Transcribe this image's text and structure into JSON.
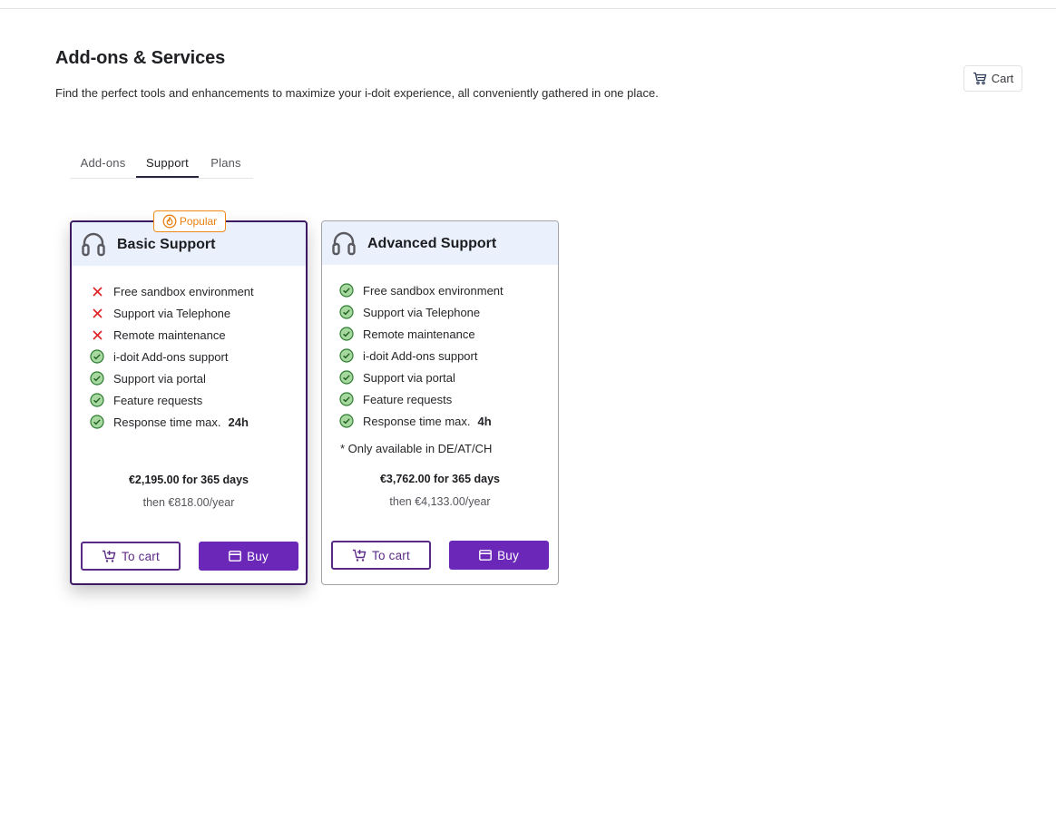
{
  "header": {
    "title": "Add-ons & Services",
    "subtitle": "Find the perfect tools and enhancements to maximize your i-doit experience, all conveniently gathered in one place.",
    "cart_label": "Cart",
    "cart_icon": "cart-icon"
  },
  "tabs": [
    {
      "label": "Add-ons",
      "active": false
    },
    {
      "label": "Support",
      "active": true
    },
    {
      "label": "Plans",
      "active": false
    }
  ],
  "colors": {
    "accent": "#6a27b8",
    "card_header_bg": "#eaf1fc",
    "popular": "#ef8a1a",
    "check": "#43a047",
    "cross": "#e02020"
  },
  "cards": [
    {
      "title": "Basic Support",
      "icon": "headset-icon",
      "badge": "Popular",
      "features": [
        {
          "label": "Free sandbox environment",
          "included": false
        },
        {
          "label": "Support via Telephone",
          "included": false
        },
        {
          "label": "Remote maintenance",
          "included": false
        },
        {
          "label": "i-doit Add-ons support",
          "included": true
        },
        {
          "label": "Support via portal",
          "included": true
        },
        {
          "label": "Feature requests",
          "included": true
        },
        {
          "label": "Response time max.",
          "included": true,
          "value": "24h"
        }
      ],
      "note": "",
      "price": "€2,195.00 for 365 days",
      "renewal": "then €818.00/year",
      "to_cart_label": "To cart",
      "buy_label": "Buy"
    },
    {
      "title": "Advanced Support",
      "icon": "headset-icon",
      "badge": "",
      "features": [
        {
          "label": "Free sandbox environment",
          "included": true
        },
        {
          "label": "Support via Telephone",
          "included": true
        },
        {
          "label": "Remote maintenance",
          "included": true
        },
        {
          "label": "i-doit Add-ons support",
          "included": true
        },
        {
          "label": "Support via portal",
          "included": true
        },
        {
          "label": "Feature requests",
          "included": true
        },
        {
          "label": "Response time max.",
          "included": true,
          "value": "4h"
        }
      ],
      "note": "* Only available in DE/AT/CH",
      "price": "€3,762.00 for 365 days",
      "renewal": "then €4,133.00/year",
      "to_cart_label": "To cart",
      "buy_label": "Buy"
    }
  ]
}
